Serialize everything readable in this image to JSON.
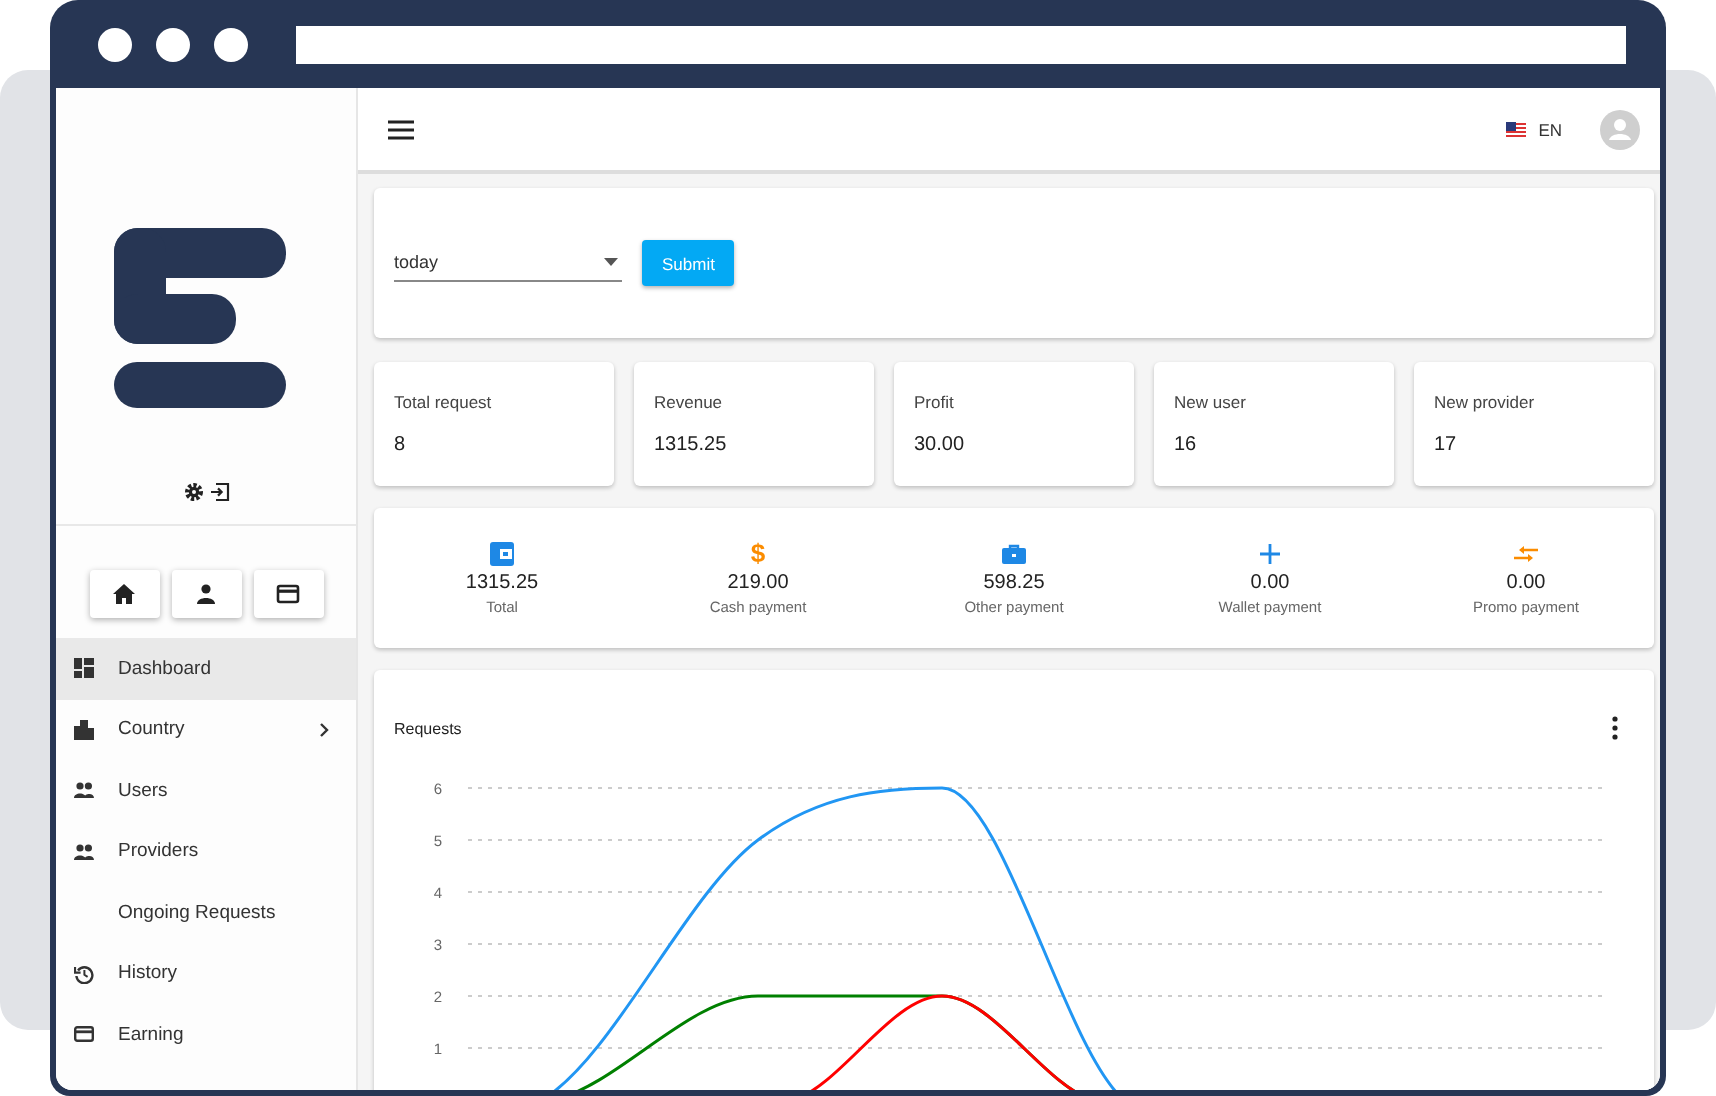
{
  "sidebar": {
    "nav_items": [
      {
        "label": "Dashboard",
        "kind": "grid",
        "selected": true,
        "has_submenu": false
      },
      {
        "label": "Country",
        "kind": "buildings",
        "selected": false,
        "has_submenu": true
      },
      {
        "label": "Users",
        "kind": "people",
        "selected": false,
        "has_submenu": false
      },
      {
        "label": "Providers",
        "kind": "people",
        "selected": false,
        "has_submenu": false
      },
      {
        "label": "Ongoing Requests",
        "kind": "none",
        "selected": false,
        "has_submenu": false
      },
      {
        "label": "History",
        "kind": "clock",
        "selected": false,
        "has_submenu": false
      },
      {
        "label": "Earning",
        "kind": "card",
        "selected": false,
        "has_submenu": false
      }
    ]
  },
  "top_bar": {
    "language": "EN"
  },
  "filter": {
    "period": "today",
    "button": "Submit"
  },
  "stats": [
    {
      "label": "Total request",
      "value": "8"
    },
    {
      "label": "Revenue",
      "value": "1315.25"
    },
    {
      "label": "Profit",
      "value": "30.00"
    },
    {
      "label": "New user",
      "value": "16"
    },
    {
      "label": "New provider",
      "value": "17"
    }
  ],
  "payments": [
    {
      "kind": "wallet",
      "color": "#1e88e5",
      "value": "1315.25",
      "label": "Total"
    },
    {
      "kind": "dollar",
      "symbol": "$",
      "color": "#fb8c00",
      "value": "219.00",
      "label": "Cash payment"
    },
    {
      "kind": "briefcase",
      "color": "#1e88e5",
      "value": "598.25",
      "label": "Other payment"
    },
    {
      "kind": "plus",
      "color": "#1e88e5",
      "value": "0.00",
      "label": "Wallet payment"
    },
    {
      "kind": "arrows",
      "color": "#fb8c00",
      "value": "0.00",
      "label": "Promo payment"
    }
  ],
  "requests_chart": {
    "title": "Requests",
    "y_axis_labels": [
      "6",
      "5",
      "4",
      "3",
      "2",
      "1"
    ]
  }
}
